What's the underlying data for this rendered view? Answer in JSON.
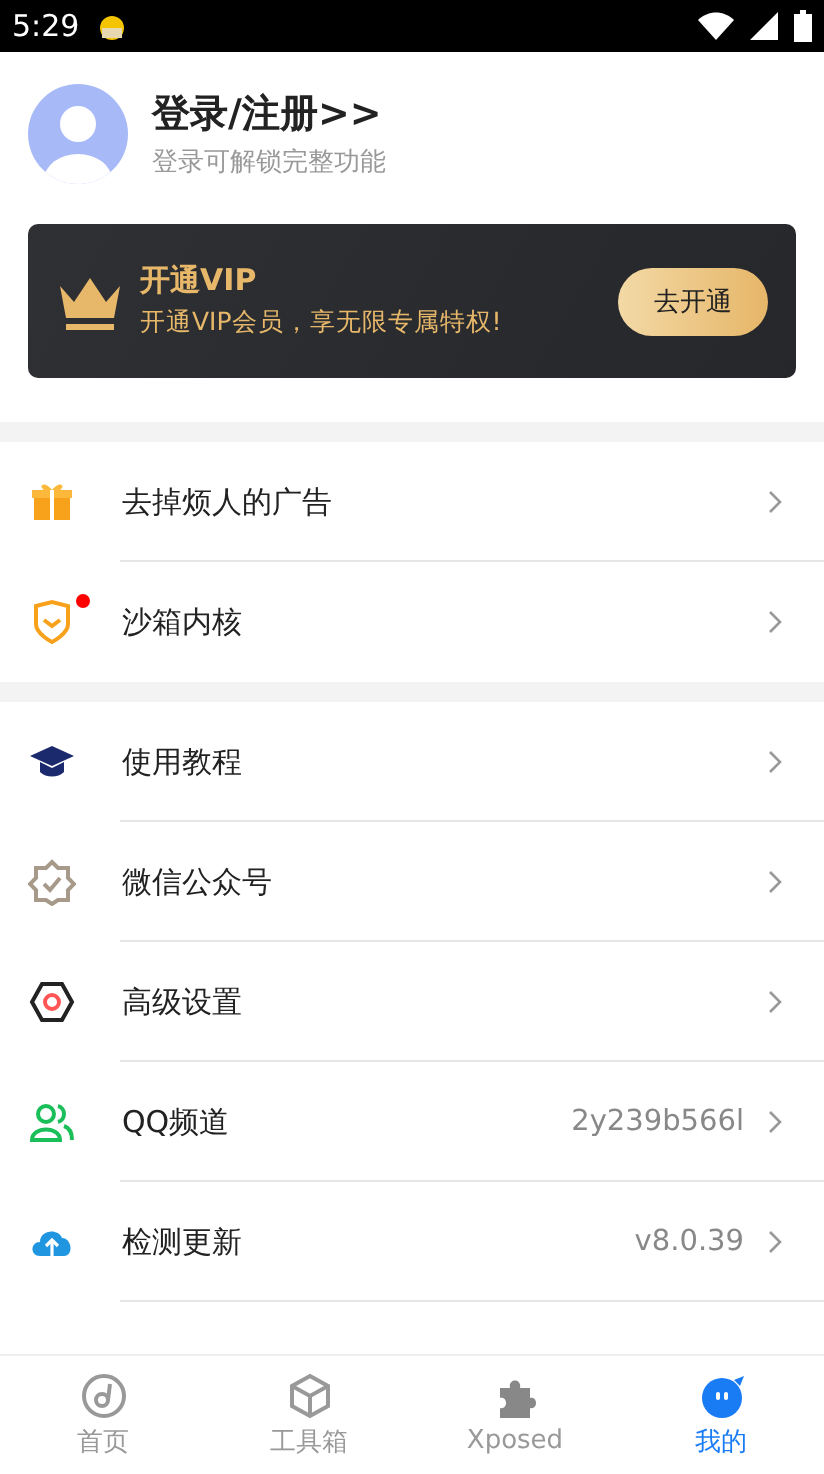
{
  "status_bar": {
    "time": "5:29"
  },
  "profile": {
    "title": "登录/注册>>",
    "subtitle": "登录可解锁完整功能"
  },
  "vip": {
    "title": "开通VIP",
    "subtitle": "开通VIP会员，享无限专属特权!",
    "button": "去开通"
  },
  "groups": [
    {
      "rows": [
        {
          "label": "去掉烦人的广告",
          "badge": false
        },
        {
          "label": "沙箱内核",
          "badge": true
        }
      ]
    },
    {
      "rows": [
        {
          "label": "使用教程",
          "badge": false
        },
        {
          "label": "微信公众号",
          "badge": false
        },
        {
          "label": "高级设置",
          "badge": false
        },
        {
          "label": "QQ频道",
          "value": "2y239b566l",
          "badge": false
        },
        {
          "label": "检测更新",
          "value": "v8.0.39",
          "badge": false
        }
      ]
    }
  ],
  "nav": [
    {
      "label": "首页",
      "selected": false
    },
    {
      "label": "工具箱",
      "selected": false
    },
    {
      "label": "Xposed",
      "selected": false
    },
    {
      "label": "我的",
      "selected": true
    }
  ]
}
